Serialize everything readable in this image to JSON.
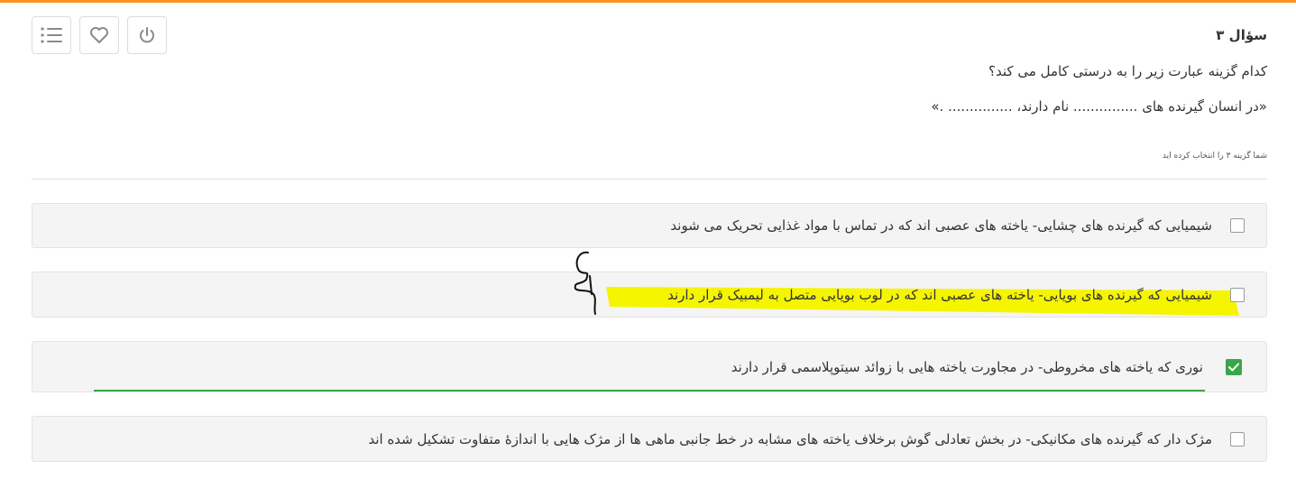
{
  "toolbar": {
    "buttons": [
      {
        "icon": "list-icon"
      },
      {
        "icon": "heart-icon"
      },
      {
        "icon": "power-icon"
      }
    ]
  },
  "question": {
    "title": "سؤال ۳",
    "text": "کدام گزینه عبارت زیر را به درستی کامل می کند؟",
    "statement": "«در انسان گیرنده های ............... نام دارند، ............... .»",
    "selected_note": "شما گزینه ۳ را انتخاب کرده اید"
  },
  "options": [
    {
      "label": "شیمیایی که گیرنده های چشایی- یاخته های عصبی اند که در تماس با مواد غذایی تحریک می شوند",
      "checked": false
    },
    {
      "label": "شیمیایی که گیرنده های بویایی- یاخته های عصبی اند که در لوب بویایی متصل به لیمبیک قرار دارند",
      "checked": false,
      "highlighted": true
    },
    {
      "label": "نوری که یاخته های مخروطی- در مجاورت یاخته هایی با زوائد سیتوپلاسمی قرار دارند",
      "checked": true,
      "correct": true
    },
    {
      "label": "مژک دار که گیرنده های مکانیکی- در بخش تعادلی گوش برخلاف یاخته های مشابه در خط جانبی ماهی ها از مژک هایی با اندازهٔ متفاوت تشکیل شده اند",
      "checked": false
    }
  ],
  "colors": {
    "accent_top": "#f7941d",
    "correct": "#3aa64a",
    "highlight": "#f5f500"
  }
}
